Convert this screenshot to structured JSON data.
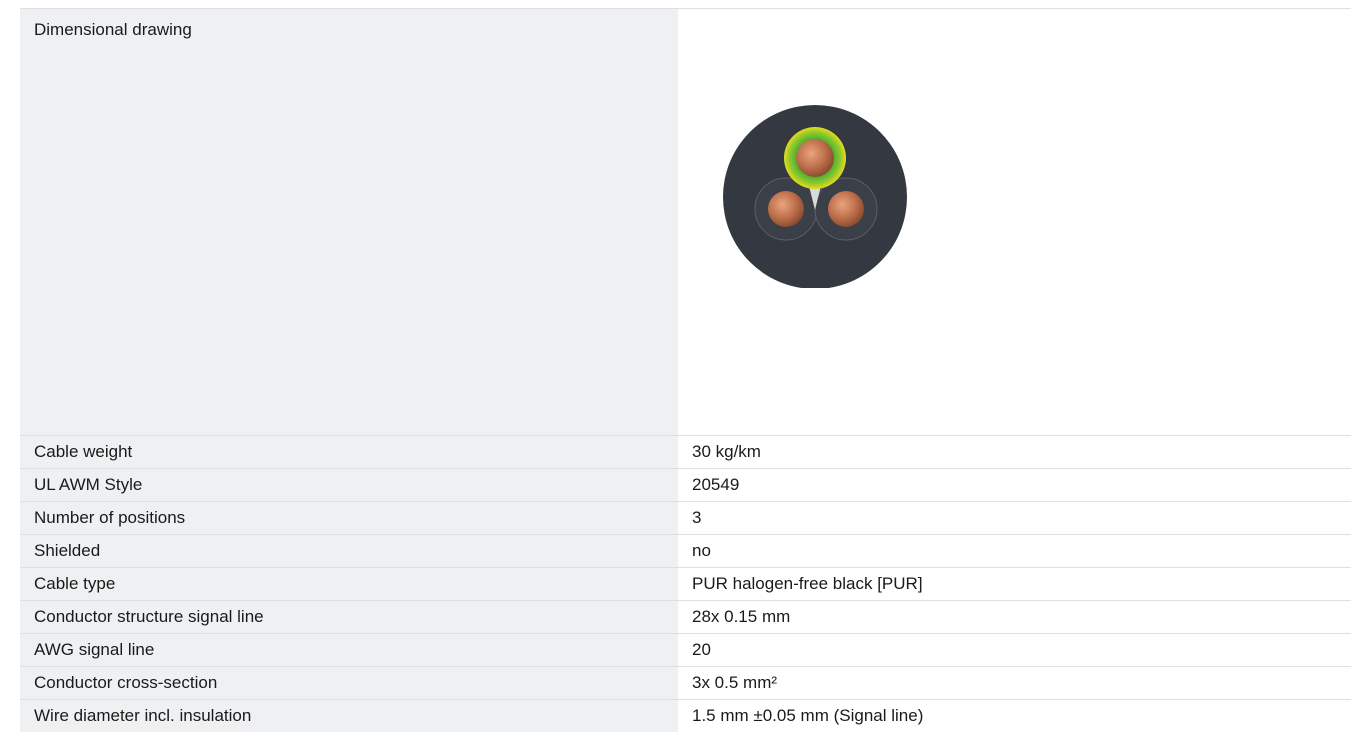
{
  "specs": {
    "drawing_label": "Dimensional drawing",
    "rows": [
      {
        "label": "Cable weight",
        "value": "30 kg/km"
      },
      {
        "label": "UL AWM Style",
        "value": "20549"
      },
      {
        "label": "Number of positions",
        "value": "3"
      },
      {
        "label": "Shielded",
        "value": "no"
      },
      {
        "label": "Cable type",
        "value": "PUR halogen-free black [PUR]"
      },
      {
        "label": "Conductor structure signal line",
        "value": "28x 0.15 mm"
      },
      {
        "label": "AWG signal line",
        "value": "20"
      },
      {
        "label": "Conductor cross-section",
        "value": "3x 0.5 mm²"
      },
      {
        "label": "Wire diameter incl. insulation",
        "value": "1.5 mm ±0.05 mm (Signal line)"
      }
    ]
  },
  "drawing": {
    "icon": "cable-cross-section-icon",
    "colors": {
      "jacket": "#333841",
      "copper": "#c0724e",
      "ground_green": "#48b230",
      "ground_yellow": "#e6dc1e"
    }
  }
}
